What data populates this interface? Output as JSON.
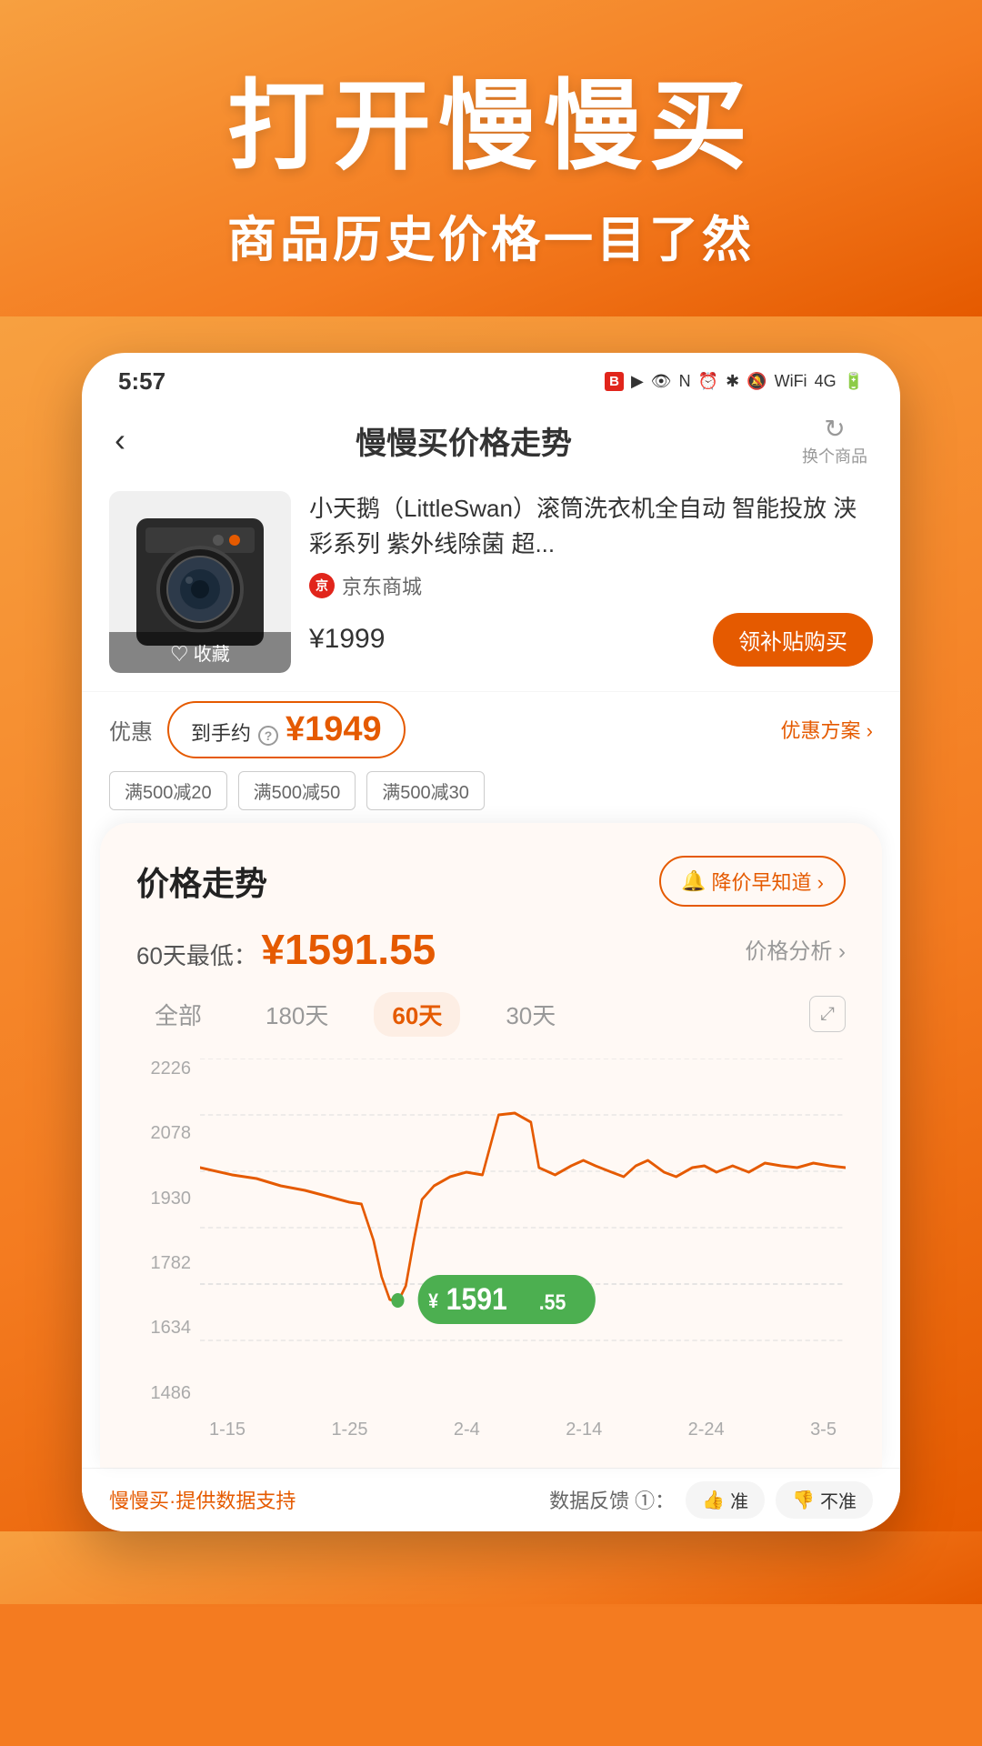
{
  "hero": {
    "title": "打开慢慢买",
    "subtitle": "商品历史价格一目了然"
  },
  "status_bar": {
    "time": "5:57",
    "icons": "● ● ◎ ⑂ ☆ ◎ ≋ 46 ▋ 🔋"
  },
  "nav": {
    "back": "‹",
    "title": "慢慢买价格走势",
    "refresh_icon": "↻",
    "refresh_label": "换个商品"
  },
  "product": {
    "name": "小天鹅（LittleSwan）滚筒洗衣机全自动 智能投放 浃彩系列 紫外线除菌 超...",
    "shop": "京东商城",
    "price_original": "¥1999",
    "favorite": "♡ 收藏",
    "buy_btn": "领补贴购买"
  },
  "discount": {
    "label": "优惠",
    "to_hand": "到手约",
    "question": "?",
    "price": "¥1949",
    "link": "优惠方案 ›",
    "coupons": [
      "满500减20",
      "满500减50",
      "满500减30"
    ]
  },
  "trend": {
    "title": "价格走势",
    "alert_btn": "降价早知道 ›",
    "min_label": "60天最低：",
    "min_price": "¥1591.55",
    "analysis_link": "价格分析 ›",
    "periods": [
      "全部",
      "180天",
      "60天",
      "30天"
    ],
    "active_period": "60天",
    "y_labels": [
      "2226",
      "2078",
      "1930",
      "1782",
      "1634",
      "1486"
    ],
    "x_labels": [
      "1-15",
      "1-25",
      "2-4",
      "2-14",
      "2-24",
      "3-5"
    ],
    "tooltip_price": "¥1591.55",
    "tooltip_main": "1591",
    "tooltip_decimal": ".55"
  },
  "bottom": {
    "brand": "慢慢买·提供数据支持",
    "feedback": "数据反馈 ①：",
    "vote_up": "👍 准",
    "vote_down": "👎 不准"
  }
}
